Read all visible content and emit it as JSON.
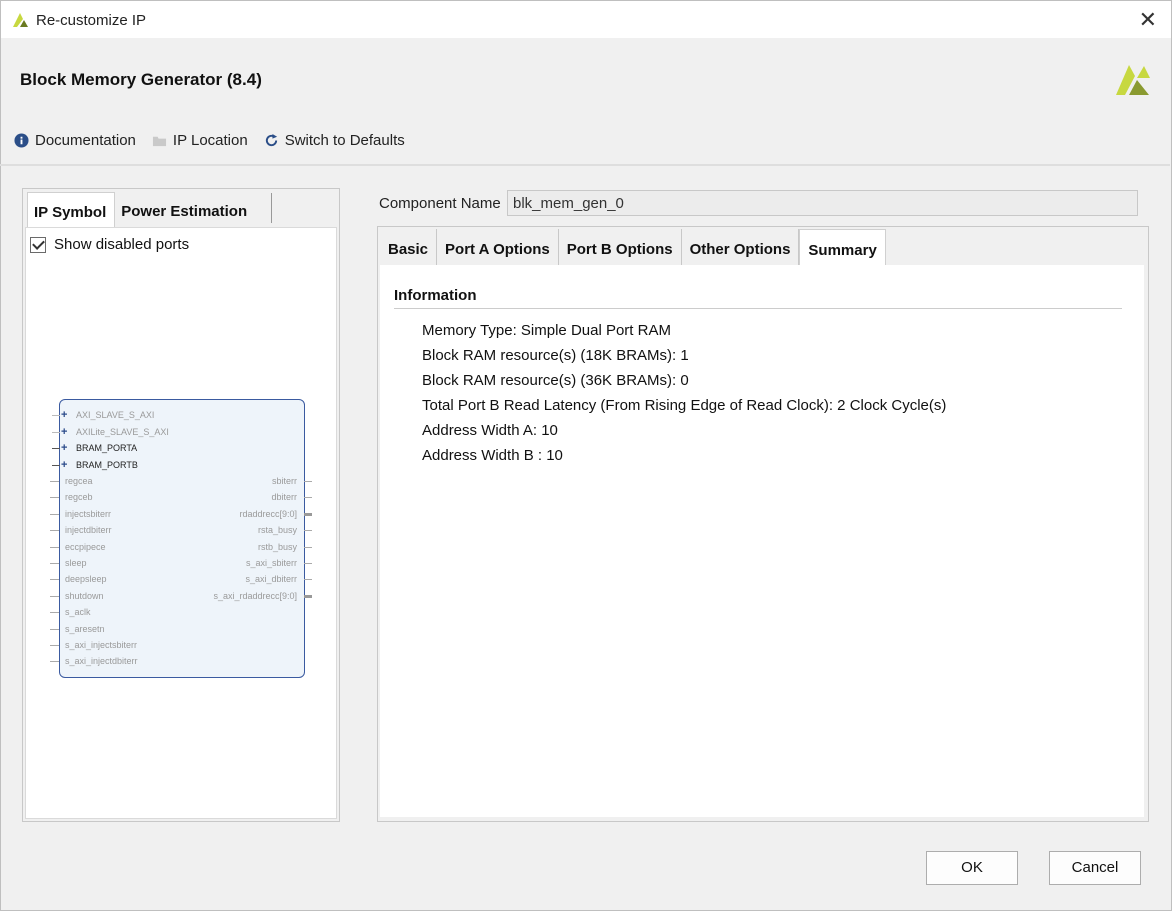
{
  "window": {
    "title": "Re-customize IP"
  },
  "header": {
    "title": "Block Memory Generator (8.4)"
  },
  "toolbar": {
    "documentation": "Documentation",
    "ip_location": "IP Location",
    "switch_defaults": "Switch to Defaults"
  },
  "left_panel": {
    "tabs": [
      "IP Symbol",
      "Power Estimation"
    ],
    "show_disabled_ports": "Show disabled ports"
  },
  "ip_symbol": {
    "bus_ports": [
      "AXI_SLAVE_S_AXI",
      "AXILite_SLAVE_S_AXI",
      "BRAM_PORTA",
      "BRAM_PORTB"
    ],
    "left_ports": [
      "regcea",
      "regceb",
      "injectsbiterr",
      "injectdbiterr",
      "eccpipece",
      "sleep",
      "deepsleep",
      "shutdown",
      "s_aclk",
      "s_aresetn",
      "s_axi_injectsbiterr",
      "s_axi_injectdbiterr"
    ],
    "right_ports": [
      "sbiterr",
      "dbiterr",
      "rdaddrecc[9:0]",
      "rsta_busy",
      "rstb_busy",
      "s_axi_sbiterr",
      "s_axi_dbiterr",
      "s_axi_rdaddrecc[9:0]"
    ]
  },
  "component": {
    "label": "Component Name",
    "value": "blk_mem_gen_0"
  },
  "right_tabs": [
    "Basic",
    "Port A Options",
    "Port B Options",
    "Other Options",
    "Summary"
  ],
  "summary": {
    "heading": "Information",
    "lines": [
      "Memory Type: Simple Dual Port RAM",
      "Block RAM resource(s) (18K BRAMs): 1",
      "Block RAM resource(s) (36K BRAMs): 0",
      "Total Port B Read Latency (From Rising Edge of Read Clock): 2 Clock Cycle(s)",
      "Address Width A: 10",
      "Address Width B : 10"
    ]
  },
  "buttons": {
    "ok": "OK",
    "cancel": "Cancel"
  }
}
